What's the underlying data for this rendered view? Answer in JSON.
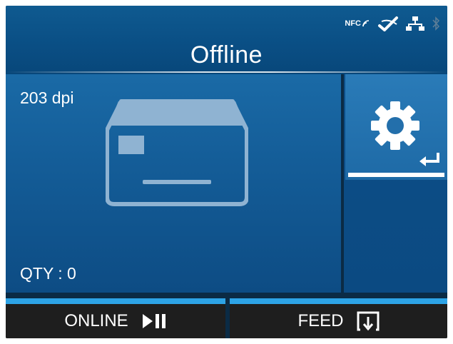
{
  "header": {
    "title": "Offline",
    "status_icons": [
      "nfc-icon",
      "wireless-icon",
      "network-icon",
      "bluetooth-icon"
    ],
    "nfc_label": "NFC"
  },
  "main": {
    "resolution": "203 dpi",
    "quantity": "QTY : 0",
    "printer_icon": "printer-icon"
  },
  "side": {
    "settings_icon": "gear-icon",
    "enter_icon": "enter-icon"
  },
  "footer": {
    "left_label": "ONLINE",
    "left_icon": "play-pause-icon",
    "right_label": "FEED",
    "right_icon": "feed-icon"
  },
  "colors": {
    "accent": "#2da3e6",
    "panel": "#145d98",
    "footer": "#1e1e1e"
  }
}
